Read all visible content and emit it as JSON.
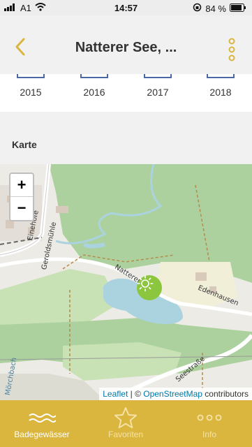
{
  "status_bar": {
    "carrier": "A1",
    "time": "14:57",
    "battery": "84 %"
  },
  "header": {
    "title": "Natterer See, ..."
  },
  "years": [
    "2015",
    "2016",
    "2017",
    "2018"
  ],
  "section": {
    "map_title": "Karte"
  },
  "map": {
    "zoom_in": "+",
    "zoom_out": "−",
    "labels": {
      "einehofe": "Einehofe",
      "geroldsmuhle": "Geroldsmühle",
      "natterer": "Natterer",
      "edenhausen": "Edenhausen",
      "seestrasse": "Seestraße",
      "marchbach": "Mörchbach"
    },
    "attribution": {
      "leaflet": "Leaflet",
      "sep": " | © ",
      "osm": "OpenStreetMap",
      "suffix": " contributors"
    }
  },
  "tabs": [
    {
      "label": "Badegewässer",
      "icon": "waves-icon"
    },
    {
      "label": "Favoriten",
      "icon": "star-icon"
    },
    {
      "label": "Info",
      "icon": "dots-icon"
    }
  ],
  "colors": {
    "accent": "#dab63f",
    "lake": "#aad3df",
    "forest": "#add19e",
    "pin": "#8cc63f"
  }
}
